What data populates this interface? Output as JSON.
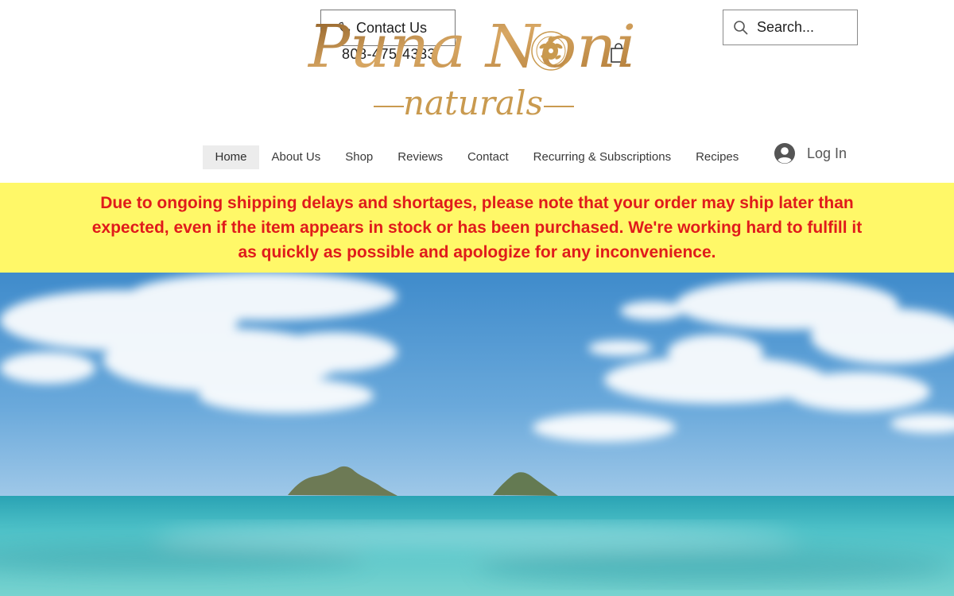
{
  "header": {
    "contact_label": "Contact Us",
    "phone_number": "808-475-4333",
    "logo_text_main": "Puna Noni",
    "logo_text_sub": "naturals",
    "logo_color": "#c99a4f",
    "search": {
      "placeholder": "Search..."
    },
    "icons": {
      "phone": "phone-icon",
      "cart": "cart-icon",
      "search": "search-icon",
      "avatar": "avatar-icon"
    }
  },
  "nav": {
    "items": [
      {
        "label": "Home",
        "active": true
      },
      {
        "label": "About Us"
      },
      {
        "label": "Shop"
      },
      {
        "label": "Reviews"
      },
      {
        "label": "Contact"
      },
      {
        "label": "Recurring & Subscriptions"
      },
      {
        "label": "Recipes"
      }
    ],
    "login_label": "Log In"
  },
  "notice": {
    "text": "Due to ongoing shipping delays and shortages, please note that your order may ship later than expected, even if the item appears in stock or has been purchased. We're working hard to fulfill it as quickly as possible and apologize for any inconvenience.",
    "background": "#fff868",
    "text_color": "#e01b1b"
  },
  "hero": {
    "sky_color": "#4f95cf",
    "ocean_color": "#5ec9cd"
  }
}
